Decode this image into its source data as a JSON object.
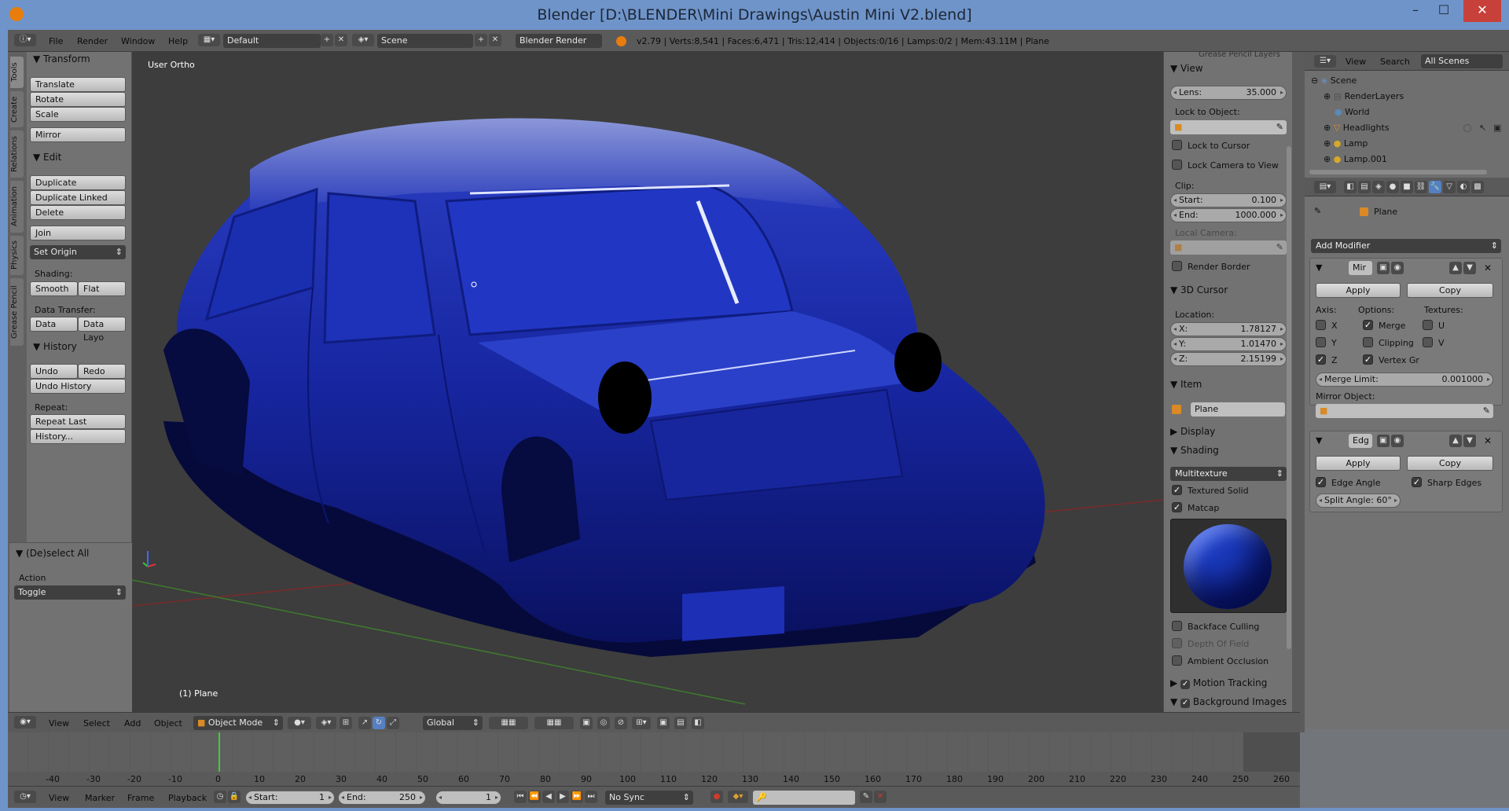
{
  "window": {
    "title": "Blender [D:\\BLENDER\\Mini Drawings\\Austin Mini V2.blend]",
    "minimize": "–",
    "maximize": "☐",
    "close": "✕"
  },
  "info": {
    "menus": [
      "File",
      "Render",
      "Window",
      "Help"
    ],
    "layout": "Default",
    "scene": "Scene",
    "engine": "Blender Render",
    "stats": "v2.79 | Verts:8,541 | Faces:6,471 | Tris:12,414 | Objects:0/16 | Lamps:0/2 | Mem:43.11M | Plane"
  },
  "tabs": [
    "Tools",
    "Create",
    "Relations",
    "Animation",
    "Physics",
    "Grease Pencil"
  ],
  "toolshelf": {
    "transform": {
      "header": "Transform",
      "buttons": [
        "Translate",
        "Rotate",
        "Scale",
        "Mirror"
      ]
    },
    "edit": {
      "header": "Edit",
      "buttons": [
        "Duplicate",
        "Duplicate Linked",
        "Delete",
        "Join"
      ],
      "set_origin": "Set Origin",
      "shading_label": "Shading:",
      "smooth": "Smooth",
      "flat": "Flat",
      "data_transfer_label": "Data Transfer:",
      "data": "Data",
      "data_layo": "Data Layo"
    },
    "history": {
      "header": "History",
      "undo": "Undo",
      "redo": "Redo",
      "undo_history": "Undo History",
      "repeat_label": "Repeat:",
      "repeat_last": "Repeat Last",
      "history": "History..."
    },
    "operator": {
      "header": "(De)select All",
      "action_label": "Action",
      "action_value": "Toggle"
    }
  },
  "viewport": {
    "view_label": "User Ortho",
    "object_label": "(1) Plane",
    "colors": {
      "car": "#1a2aa8",
      "bg": "#3d3d3d"
    }
  },
  "npanel": {
    "grease_pencil": "Grease Pencil Layers",
    "view": {
      "header": "View",
      "lens_label": "Lens:",
      "lens_value": "35.000",
      "lock_to_object": "Lock to Object:",
      "lock_to_cursor": "Lock to Cursor",
      "lock_camera": "Lock Camera to View",
      "clip": "Clip:",
      "start_label": "Start:",
      "start_value": "0.100",
      "end_label": "End:",
      "end_value": "1000.000",
      "local_camera": "Local Camera:",
      "render_border": "Render Border"
    },
    "cursor": {
      "header": "3D Cursor",
      "location": "Location:",
      "x_label": "X:",
      "x_value": "1.78127",
      "y_label": "Y:",
      "y_value": "1.01470",
      "z_label": "Z:",
      "z_value": "2.15199"
    },
    "item": {
      "header": "Item",
      "name": "Plane"
    },
    "display": {
      "header": "Display"
    },
    "shading": {
      "header": "Shading",
      "mode": "Multitexture",
      "textured_solid": "Textured Solid",
      "matcap": "Matcap",
      "backface": "Backface Culling",
      "depth_of_field": "Depth Of Field",
      "ambient_occlusion": "Ambient Occlusion"
    },
    "motion_tracking": "Motion Tracking",
    "background_images": "Background Images"
  },
  "outliner": {
    "view": "View",
    "search": "Search",
    "filter": "All Scenes",
    "items": [
      "Scene",
      "RenderLayers",
      "World",
      "Headlights",
      "Lamp",
      "Lamp.001"
    ]
  },
  "properties": {
    "object": "Plane",
    "add_modifier": "Add Modifier",
    "mirror": {
      "name": "Mir",
      "apply": "Apply",
      "copy": "Copy",
      "axis": "Axis:",
      "options": "Options:",
      "textures": "Textures:",
      "x": "X",
      "y": "Y",
      "z": "Z",
      "merge": "Merge",
      "clipping": "Clipping",
      "vertex_groups": "Vertex Gr",
      "u": "U",
      "v": "V",
      "merge_limit_label": "Merge Limit:",
      "merge_limit_value": "0.001000",
      "mirror_object": "Mirror Object:"
    },
    "edge_split": {
      "name": "Edg",
      "apply": "Apply",
      "copy": "Copy",
      "edge_angle": "Edge Angle",
      "sharp_edges": "Sharp Edges",
      "split_angle": "Split Angle: 60°"
    }
  },
  "view3d_header": {
    "menus": [
      "View",
      "Select",
      "Add",
      "Object"
    ],
    "mode": "Object Mode",
    "orientation": "Global"
  },
  "timeline": {
    "ticks": [
      "-40",
      "-30",
      "-20",
      "-10",
      "0",
      "10",
      "20",
      "30",
      "40",
      "50",
      "60",
      "70",
      "80",
      "90",
      "100",
      "110",
      "120",
      "130",
      "140",
      "150",
      "160",
      "170",
      "180",
      "190",
      "200",
      "210",
      "220",
      "230",
      "240",
      "250",
      "260"
    ],
    "menus": [
      "View",
      "Marker",
      "Frame",
      "Playback"
    ],
    "start_label": "Start:",
    "start_value": "1",
    "end_label": "End:",
    "end_value": "250",
    "current": "1",
    "sync": "No Sync"
  }
}
